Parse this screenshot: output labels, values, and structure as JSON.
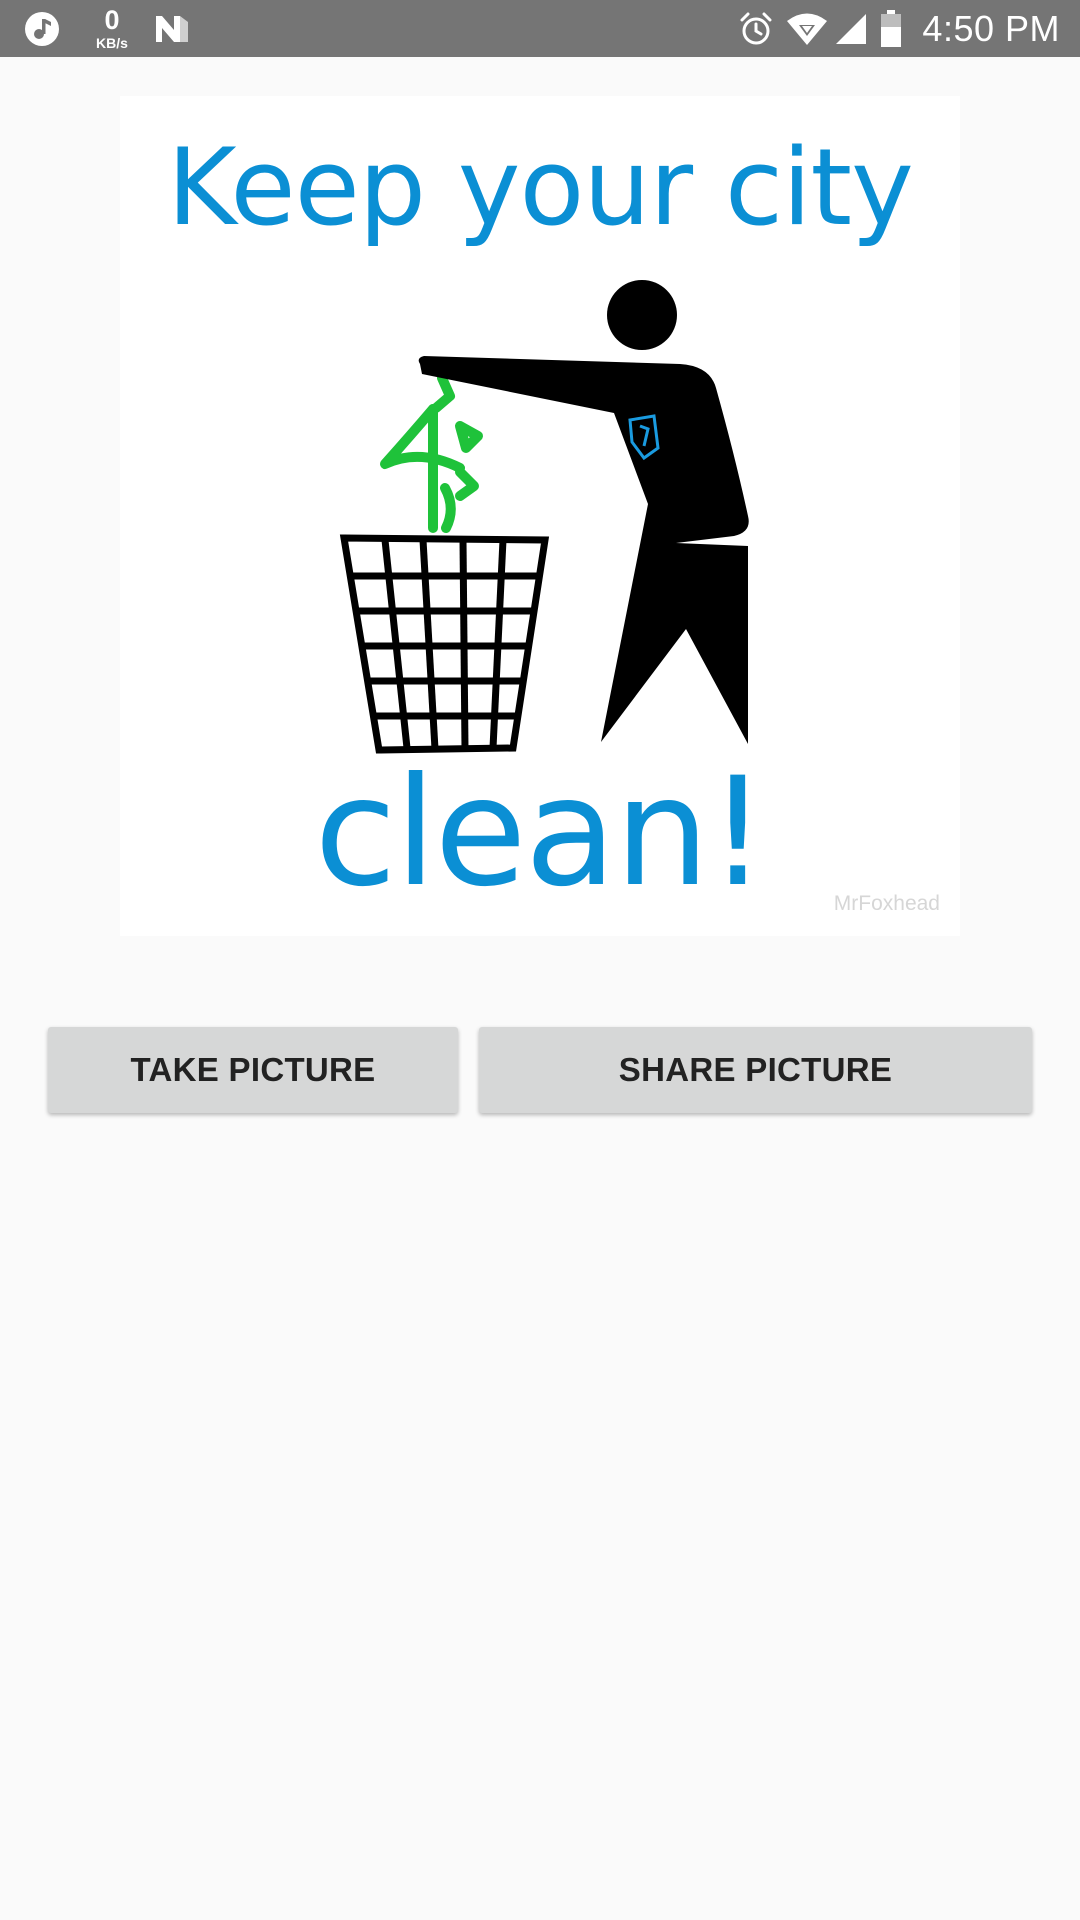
{
  "status_bar": {
    "net_speed_value": "0",
    "net_speed_unit": "KB/s",
    "time": "4:50 PM",
    "icons": [
      "music-icon",
      "n-badge-icon",
      "alarm-icon",
      "wifi-icon",
      "cell-signal-icon",
      "battery-icon"
    ],
    "background_color": "#757575"
  },
  "poster": {
    "headline": "Keep your city",
    "tagline": "clean!",
    "watermark": "MrFoxhead",
    "text_color": "#0b8fd4",
    "accent_green": "#1fc23a"
  },
  "actions": {
    "take_picture_label": "TAKE PICTURE",
    "share_picture_label": "SHARE PICTURE"
  }
}
